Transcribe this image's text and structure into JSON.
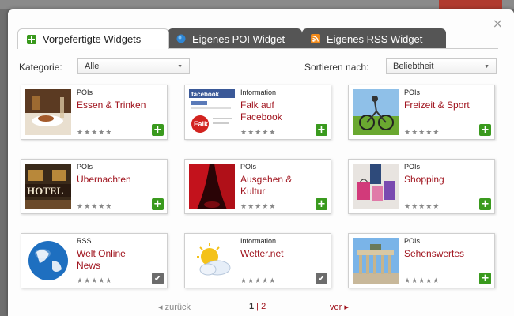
{
  "tabs": [
    {
      "label": "Vorgefertigte Widgets",
      "icon": "plus-icon",
      "active": true
    },
    {
      "label": "Eigenes POI Widget",
      "icon": "globe-icon",
      "active": false
    },
    {
      "label": "Eigenes RSS Widget",
      "icon": "rss-icon",
      "active": false
    }
  ],
  "close_label": "×",
  "filters": {
    "category_label": "Kategorie:",
    "category_value": "Alle",
    "sort_label": "Sortieren nach:",
    "sort_value": "Beliebtheit"
  },
  "widgets": [
    {
      "category": "POIs",
      "title": "Essen & Trinken",
      "stars": "★★★★★",
      "action": "add",
      "thumb": "food-image"
    },
    {
      "category": "Information",
      "title": "Falk auf Facebook",
      "stars": "★★★★★",
      "action": "add",
      "thumb": "facebook-image"
    },
    {
      "category": "POIs",
      "title": "Freizeit & Sport",
      "stars": "★★★★★",
      "action": "add",
      "thumb": "cyclist-image"
    },
    {
      "category": "POIs",
      "title": "Übernachten",
      "stars": "★★★★★",
      "action": "add",
      "thumb": "hotel-image"
    },
    {
      "category": "POIs",
      "title": "Ausgehen & Kultur",
      "stars": "★★★★★",
      "action": "add",
      "thumb": "theater-image"
    },
    {
      "category": "POIs",
      "title": "Shopping",
      "stars": "★★★★★",
      "action": "add",
      "thumb": "shopping-image"
    },
    {
      "category": "RSS",
      "title": "Welt Online News",
      "stars": "★★★★★",
      "action": "added",
      "thumb": "globe-image"
    },
    {
      "category": "Information",
      "title": "Wetter.net",
      "stars": "★★★★★",
      "action": "added",
      "thumb": "weather-image"
    },
    {
      "category": "POIs",
      "title": "Sehenswertes",
      "stars": "★★★★★",
      "action": "add",
      "thumb": "brandenburg-gate-image"
    }
  ],
  "thumb_text": {
    "facebook_header": "facebook",
    "falk_logo": "Falk",
    "hotel_sign": "HOTEL"
  },
  "pager": {
    "prev_label": "◂ zurück",
    "page1": "1",
    "separator": " | ",
    "page2": "2",
    "next_label": "vor ▸"
  },
  "colors": {
    "accent_red": "#a0141e",
    "add_green": "#3a9a1e",
    "tab_dark": "#555555"
  }
}
